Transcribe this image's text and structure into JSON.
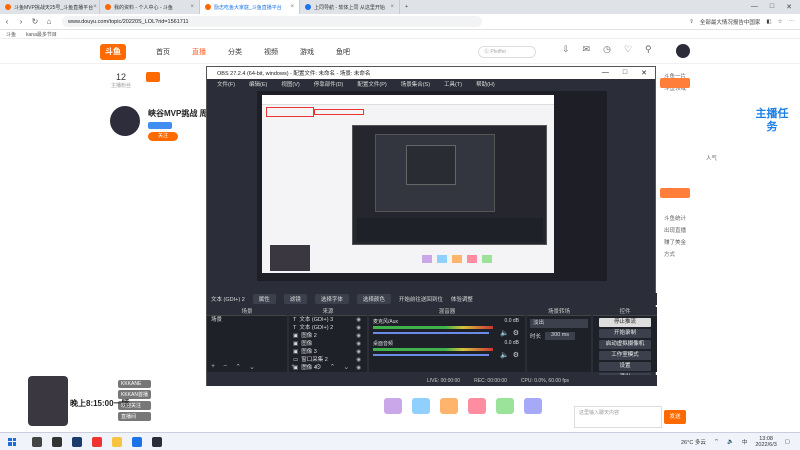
{
  "browser": {
    "tabs": [
      {
        "label": "斗鱼MVP挑战天25号_斗鱼直播平台",
        "active": false
      },
      {
        "label": "我的资料 - 个人中心 - 斗鱼",
        "active": false
      },
      {
        "label": "励志吃鱼大家庭_斗鱼直播平台",
        "active": true
      },
      {
        "label": "上同导航 - 软体上同 从这里开始",
        "active": false
      }
    ],
    "url": "www.douyu.com/topic/20220S_LOL?rid=1561711",
    "bookmarks": [
      "武汉斗鱼网络科技有限公司",
      "www.douyu.com"
    ],
    "right_tools": [
      "全部最大情况报告中国家",
      "⋯"
    ],
    "bookmark_bar": [
      "斗鱼",
      "kana最多节目"
    ]
  },
  "site": {
    "logo": "斗鱼",
    "nav": [
      "首页",
      "直播",
      "分类",
      "视频",
      "游戏",
      "鱼吧"
    ],
    "active_nav": "直播",
    "search_placeholder": "Ⓢ Pfeiffer"
  },
  "profile": {
    "fans_count": "12",
    "fans_label": "主播粉丝",
    "anchor_name": "峡谷MVP挑战 周",
    "follow_label": "关注"
  },
  "right_panel": {
    "task_badge": "主播任务",
    "texts": [
      "斗鱼一片",
      "斗鱼领域",
      "人气",
      "斗鱼统计",
      "出现直播",
      "赚了美金",
      "方式"
    ]
  },
  "obs": {
    "title": "OBS 27.2.4 (64-bit, windows) - 配置文件: 未命名 - 场景: 未命名",
    "menu": [
      "文件(F)",
      "编辑(E)",
      "视图(V)",
      "停靠部件(D)",
      "配置文件(P)",
      "场景集合(S)",
      "工具(T)",
      "帮助(H)"
    ],
    "source_toolbar": [
      "文本 (GDI+) 2",
      "属性",
      "滤镜",
      "选择字体",
      "选择颜色",
      "开始前往送回到位",
      "体验调整"
    ],
    "docks": {
      "scenes_header": "场景",
      "sources_header": "来源",
      "mixer_header": "混音器",
      "transitions_header": "场景转场",
      "controls_header": "控件"
    },
    "scenes": [
      "场景"
    ],
    "sources": [
      "文本 (GDI+) 3",
      "文本 (GDI+) 2",
      "图像 2",
      "图像",
      "图像 3",
      "窗口采集 2",
      "图像 4"
    ],
    "mixer": [
      {
        "name": "麦克风/Aux",
        "db": "0.0 dB"
      },
      {
        "name": "桌面音频",
        "db": "0.0 dB"
      }
    ],
    "transition": {
      "type": "淡出",
      "duration_label": "时长",
      "duration": "300 ms"
    },
    "controls": [
      "停止推流",
      "开始录制",
      "启动虚拟摄像机",
      "工作室模式",
      "设置",
      "退出"
    ],
    "status": [
      "LIVE: 00:00:00",
      "REC: 00:00:00",
      "CPU: 0.0%, 60.00 fps"
    ]
  },
  "overlay": {
    "time_text": "晚上8:15:00一睡",
    "list": [
      "KKKANE",
      "KKKAN首播",
      "欢迎关注",
      "直播间"
    ]
  },
  "chat": {
    "placeholder": "这里输入聊天内容",
    "send_label": "发送"
  },
  "taskbar": {
    "weather": "26°C 多云",
    "time": "13:08",
    "date": "2022/6/3"
  }
}
